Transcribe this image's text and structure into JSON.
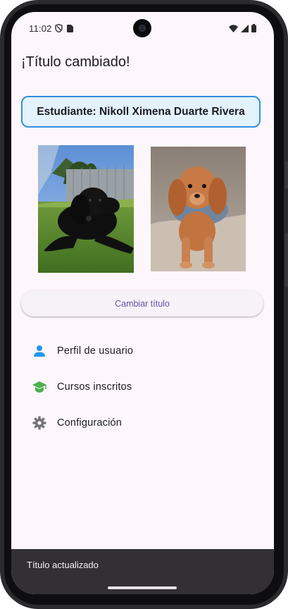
{
  "status_bar": {
    "time": "11:02",
    "left_icons": [
      "shield-icon",
      "sim-card-icon"
    ],
    "right_icons": [
      "wifi-icon",
      "signal-icon",
      "battery-icon"
    ]
  },
  "app_bar": {
    "title": "¡Título cambiado!"
  },
  "student_card": {
    "text": "Estudiante: Nikoll Ximena Duarte Rivera",
    "border_color": "#2f8fdc",
    "background_color": "#e3f2fd"
  },
  "photos": [
    {
      "icon": "black-puppy-photo"
    },
    {
      "icon": "brown-puppy-photo"
    }
  ],
  "change_button": {
    "label": "Cambiar título",
    "color": "#6750a4"
  },
  "menu": {
    "items": [
      {
        "label": "Perfil de usuario",
        "icon": "person-icon",
        "icon_color": "#2196f3"
      },
      {
        "label": "Cursos inscritos",
        "icon": "school-icon",
        "icon_color": "#4caf50"
      },
      {
        "label": "Configuración",
        "icon": "gear-icon",
        "icon_color": "#757575"
      }
    ]
  },
  "snackbar": {
    "message": "Título actualizado"
  }
}
